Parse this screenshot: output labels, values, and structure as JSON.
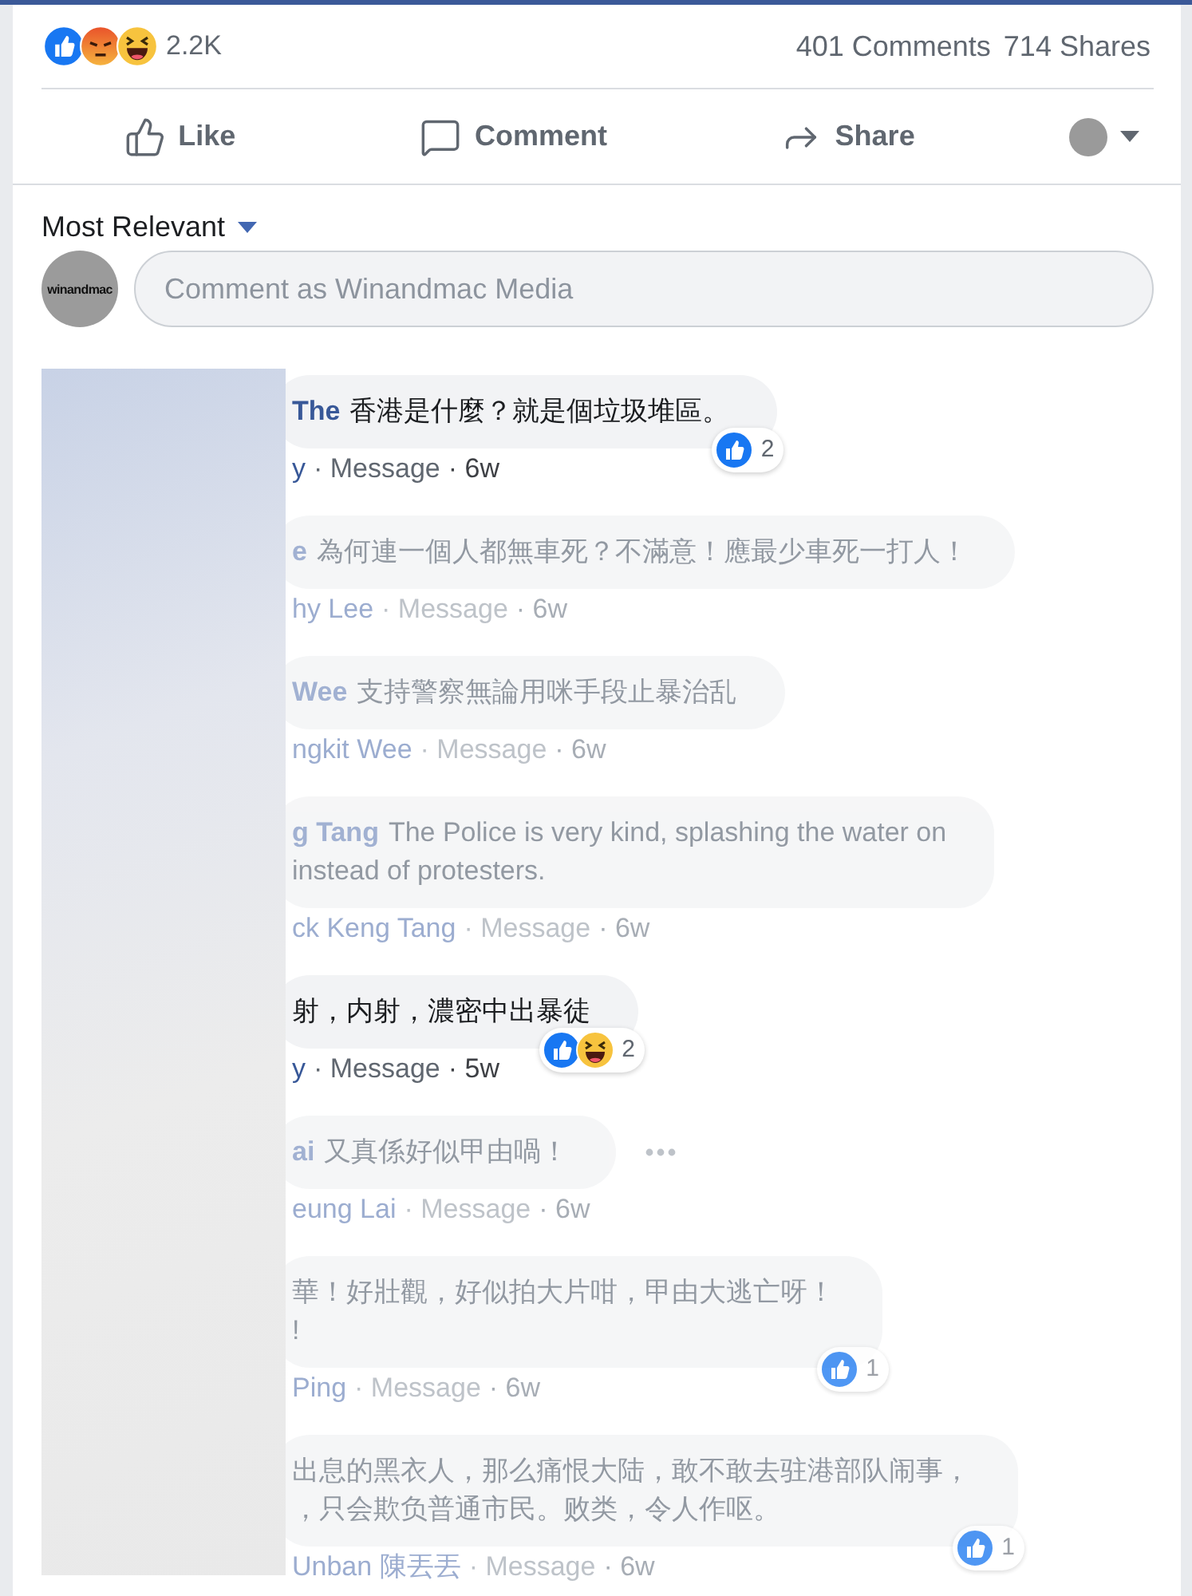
{
  "post_stats": {
    "reactions": [
      {
        "kind": "like"
      },
      {
        "kind": "angry"
      },
      {
        "kind": "haha"
      }
    ],
    "reaction_count": "2.2K",
    "comments": "401 Comments",
    "shares": "714 Shares"
  },
  "actions": [
    {
      "kind": "like",
      "label": "Like"
    },
    {
      "kind": "comment",
      "label": "Comment"
    },
    {
      "kind": "share",
      "label": "Share"
    }
  ],
  "sort": {
    "label": "Most Relevant"
  },
  "comment_input": {
    "avatar_label": "winandmac",
    "placeholder": "Comment as Winandmac Media"
  },
  "comments": [
    {
      "name": "The",
      "lines": [
        "香港是什麼？就是個垃圾堆區。"
      ],
      "author": "y",
      "action": "· Message",
      "time": "· 6w",
      "dimmed": false,
      "more": false,
      "reactions": [
        {
          "kind": "like"
        }
      ],
      "reaction_count": "2"
    },
    {
      "name": "e",
      "lines": [
        "為何連一個人都無車死？不滿意！應最少車死一打人！"
      ],
      "author": "hy Lee",
      "action": "· Message",
      "time": "· 6w",
      "dimmed": true,
      "more": false
    },
    {
      "name": "Wee",
      "lines": [
        "支持警察無論用咪手段止暴治乱"
      ],
      "author": "ngkit Wee",
      "action": "· Message",
      "time": "· 6w",
      "dimmed": true,
      "more": false
    },
    {
      "name": "g Tang",
      "lines": [
        "The Police is very kind, splashing the water on",
        "instead of protesters."
      ],
      "author": "ck Keng Tang",
      "action": "· Message",
      "time": "· 6w",
      "dimmed": true,
      "more": false
    },
    {
      "lines": [
        "射，内射，濃密中出暴徒"
      ],
      "author": "y",
      "action": "· Message",
      "time": "· 5w",
      "dimmed": false,
      "more": false,
      "reactions": [
        {
          "kind": "like"
        },
        {
          "kind": "haha"
        }
      ],
      "reaction_count": "2"
    },
    {
      "name": "ai",
      "lines": [
        "又真係好似甲由喎！"
      ],
      "author": "eung Lai",
      "action": "· Message",
      "time": "· 6w",
      "dimmed": true,
      "more": true
    },
    {
      "lines": [
        "華！好壯觀，好似拍大片咁，甲由大逃亡呀！",
        "!"
      ],
      "author": "Ping",
      "action": "· Message",
      "time": "· 6w",
      "dimmed": true,
      "more": false,
      "reactions": [
        {
          "kind": "like"
        }
      ],
      "reaction_count": "1"
    },
    {
      "lines": [
        "出息的黑衣人，那么痛恨大陆，敢不敢去驻港部队闹事，",
        "，只会欺负普通市民。败类，令人作呕。"
      ],
      "author": "Unban 陳丟丟",
      "action": "· Message",
      "time": "· 6w",
      "dimmed": true,
      "more": false,
      "reactions": [
        {
          "kind": "like"
        }
      ],
      "reaction_count": "1"
    }
  ]
}
